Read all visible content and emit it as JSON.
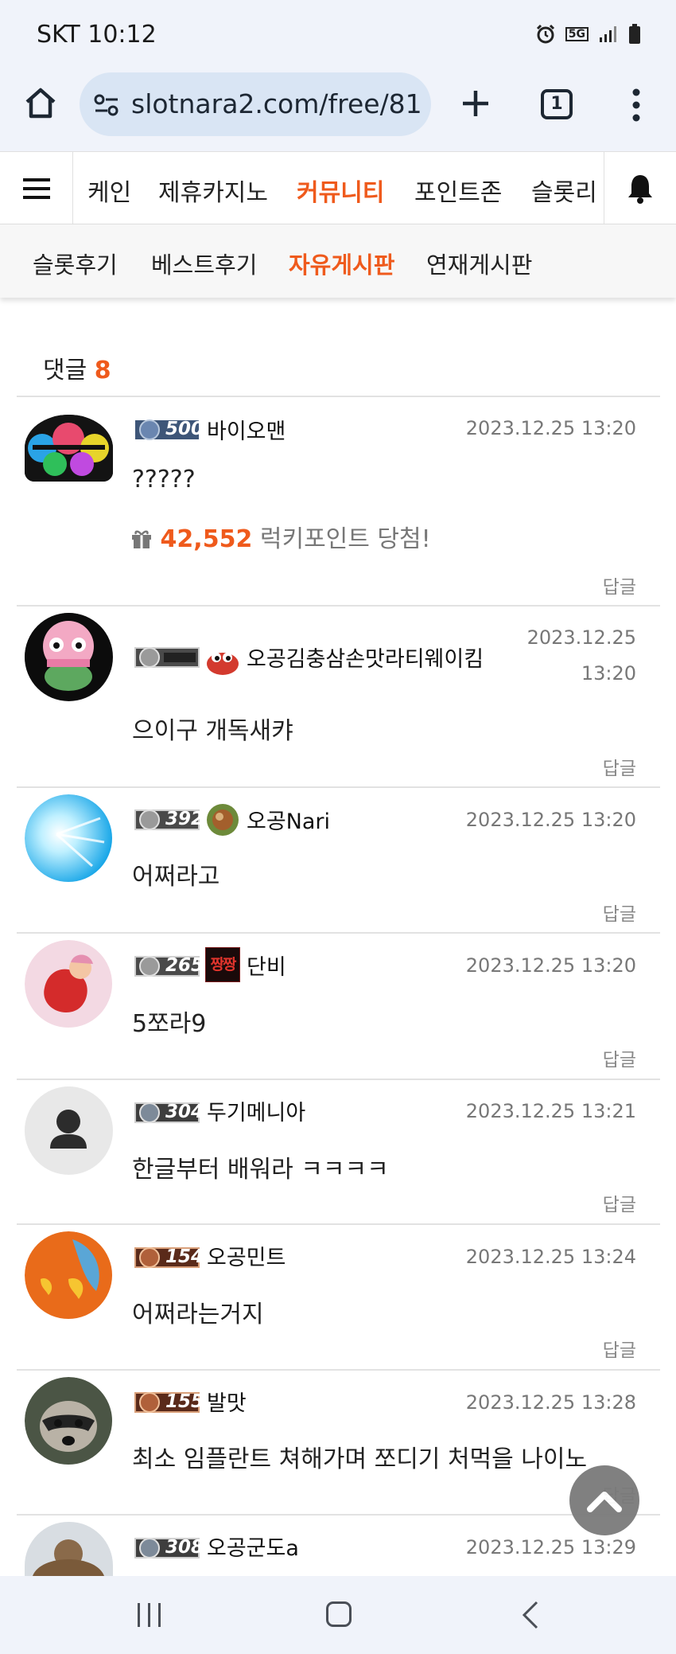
{
  "status": {
    "carrier_time": "SKT 10:12",
    "network": "5G"
  },
  "browser": {
    "url": "slotnara2.com/free/81",
    "tab_count": "1"
  },
  "nav": {
    "items": [
      {
        "label": "케인",
        "active": false
      },
      {
        "label": "제휴카지노",
        "active": false
      },
      {
        "label": "커뮤니티",
        "active": true
      },
      {
        "label": "포인트존",
        "active": false
      },
      {
        "label": "슬롯리",
        "active": false
      }
    ]
  },
  "subnav": {
    "items": [
      {
        "label": "슬롯후기",
        "active": false
      },
      {
        "label": "베스트후기",
        "active": false
      },
      {
        "label": "자유게시판",
        "active": true
      },
      {
        "label": "연재게시판",
        "active": false
      }
    ]
  },
  "comments_header": {
    "label": "댓글",
    "count": "8"
  },
  "comments": [
    {
      "level": "500",
      "nickname": "바이오맨",
      "date": "2023.12.25 13:20",
      "text": "?????",
      "lucky_points": "42,552",
      "lucky_text": "럭키포인트 당첨!",
      "reply": "답글"
    },
    {
      "level": "",
      "nickname": "오공김충삼손맛라티웨이킴",
      "date_line1": "2023.12.25",
      "date_line2": "13:20",
      "text": "으이구 개독새캬",
      "reply": "답글"
    },
    {
      "level": "392",
      "nickname": "오공Nari",
      "date": "2023.12.25 13:20",
      "text": "어쩌라고",
      "reply": "답글"
    },
    {
      "level": "265",
      "nickname": "단비",
      "badge_text": "짱짱",
      "date": "2023.12.25 13:20",
      "text": "5쪼라9",
      "reply": "답글"
    },
    {
      "level": "304",
      "nickname": "두기메니아",
      "date": "2023.12.25 13:21",
      "text": "한글부터 배워라 ㅋㅋㅋㅋ",
      "reply": "답글"
    },
    {
      "level": "154",
      "nickname": "오공민트",
      "date": "2023.12.25 13:24",
      "text": "어쩌라는거지",
      "reply": "답글"
    },
    {
      "level": "155",
      "nickname": "발맛",
      "date": "2023.12.25 13:28",
      "text": "최소 임플란트 쳐해가며 쪼디기 처먹을 나이노",
      "reply": "답글"
    },
    {
      "level": "308",
      "nickname": "오공군도a",
      "date": "2023.12.25 13:29"
    }
  ],
  "colors": {
    "accent": "#ef5a1c",
    "chrome_bg": "#f0f3fa",
    "url_pill": "#d9e5f4"
  }
}
